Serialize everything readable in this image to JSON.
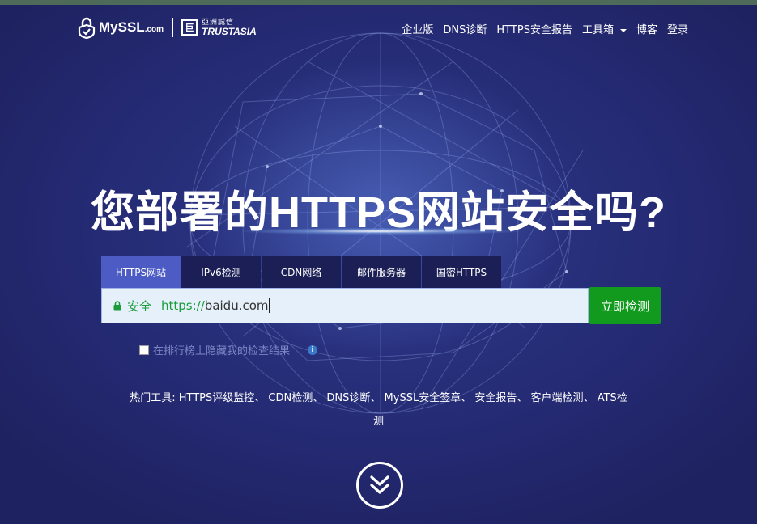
{
  "header": {
    "logo_main": "MySSL",
    "logo_domain": ".com",
    "partner_cn": "亞洲誠信",
    "partner_en": "TRUSTASIA",
    "nav": [
      {
        "label": "企业版"
      },
      {
        "label": "DNS诊断"
      },
      {
        "label": "HTTPS安全报告"
      },
      {
        "label": "工具箱"
      },
      {
        "label": "博客"
      },
      {
        "label": "登录"
      }
    ]
  },
  "hero": {
    "headline": "您部署的HTTPS网站安全吗?"
  },
  "tabs": [
    {
      "label": "HTTPS网站",
      "active": true
    },
    {
      "label": "IPv6检测"
    },
    {
      "label": "CDN网络"
    },
    {
      "label": "邮件服务器"
    },
    {
      "label": "国密HTTPS"
    }
  ],
  "search": {
    "secure_label": "安全",
    "scheme": "https://",
    "value": "baidu.com",
    "button_label": "立即检测"
  },
  "hide_option": {
    "label": "在排行榜上隐藏我的检查结果",
    "checked": false,
    "info_icon": "i"
  },
  "hot_tools": {
    "label": "热门工具:",
    "separator": "、",
    "items": [
      "HTTPS评级监控",
      "CDN检测",
      "DNS诊断",
      "MySSL安全签章",
      "安全报告",
      "客户端检测",
      "ATS检测"
    ]
  },
  "colors": {
    "background": "#23286a",
    "tab_active": "#4d5bc4",
    "button": "#119a1e",
    "secure_text": "#1b9c3a"
  }
}
